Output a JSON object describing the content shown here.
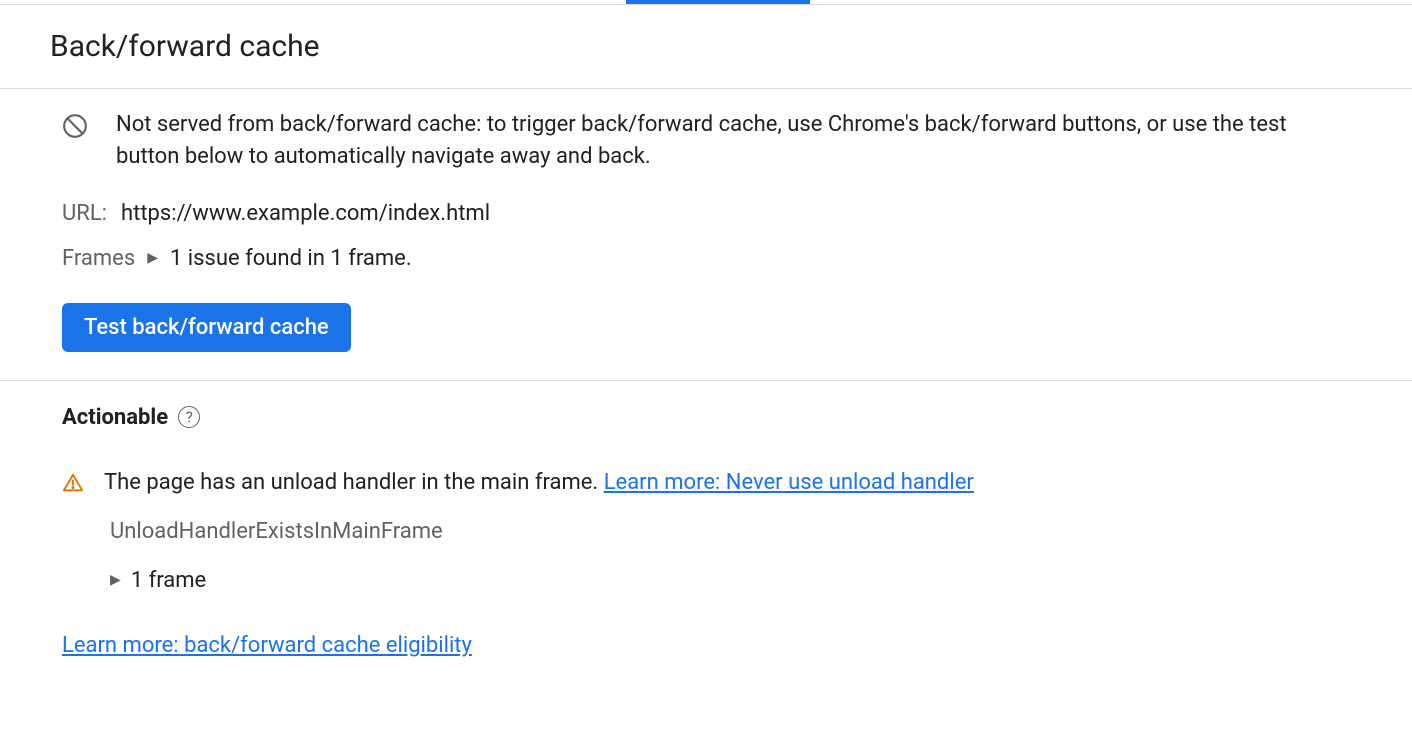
{
  "header": {
    "title": "Back/forward cache"
  },
  "info": {
    "message": "Not served from back/forward cache: to trigger back/forward cache, use Chrome's back/forward buttons, or use the test button below to automatically navigate away and back."
  },
  "url": {
    "label": "URL:",
    "value": "https://www.example.com/index.html"
  },
  "frames": {
    "label": "Frames",
    "summary": "1 issue found in 1 frame."
  },
  "button": {
    "test_label": "Test back/forward cache"
  },
  "actionable": {
    "heading": "Actionable",
    "issue_text": "The page has an unload handler in the main frame. ",
    "issue_link": "Learn more: Never use unload handler",
    "issue_code": "UnloadHandlerExistsInMainFrame",
    "frame_count": "1 frame"
  },
  "footer": {
    "learn_more": "Learn more: back/forward cache eligibility"
  }
}
